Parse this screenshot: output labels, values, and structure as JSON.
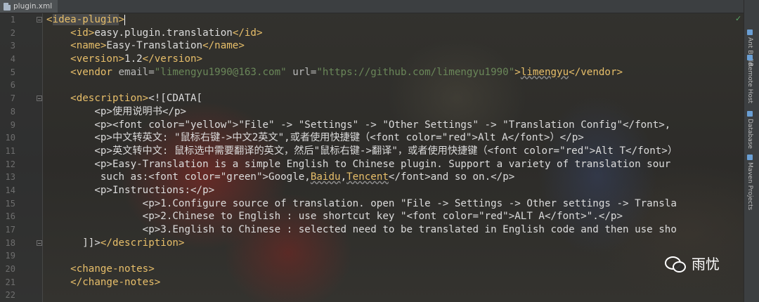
{
  "tab": {
    "label": "plugin.xml",
    "icon": "xml-file-icon"
  },
  "right_tools": [
    {
      "label": "Ant Build",
      "icon": "ant-icon"
    },
    {
      "label": "Remote Host",
      "icon": "server-icon"
    },
    {
      "label": "Database",
      "icon": "database-icon"
    },
    {
      "label": "Maven Projects",
      "icon": "maven-icon"
    }
  ],
  "status": {
    "icon": "check-icon",
    "glyph": "✓"
  },
  "watermark": {
    "text": "雨忧",
    "icon": "wechat-icon"
  },
  "lines": [
    {
      "n": "1",
      "s": [
        [
          "t",
          "<"
        ],
        [
          "hl",
          "idea-plugin"
        ],
        [
          "t",
          ">"
        ]
      ],
      "cursor": true,
      "fold": true
    },
    {
      "n": "2",
      "s": [
        [
          "t",
          "    <id>"
        ],
        [
          "tx",
          "easy.plugin.translation"
        ],
        [
          "t",
          "</id>"
        ]
      ]
    },
    {
      "n": "3",
      "s": [
        [
          "t",
          "    <name>"
        ],
        [
          "tx",
          "Easy-Translation"
        ],
        [
          "t",
          "</name>"
        ]
      ]
    },
    {
      "n": "4",
      "s": [
        [
          "t",
          "    <version>"
        ],
        [
          "tx",
          "1.2"
        ],
        [
          "t",
          "</version>"
        ]
      ]
    },
    {
      "n": "5",
      "s": [
        [
          "t",
          "    <vendor "
        ],
        [
          "at",
          "email="
        ],
        [
          "v",
          "\"limengyu1990@163.com\""
        ],
        [
          "at",
          " url="
        ],
        [
          "v",
          "\"https://github.com/limengyu1990\""
        ],
        [
          "t",
          ">"
        ],
        [
          "u",
          "limengyu"
        ],
        [
          "t",
          "</vendor>"
        ]
      ]
    },
    {
      "n": "6",
      "s": []
    },
    {
      "n": "7",
      "s": [
        [
          "t",
          "    <description>"
        ],
        [
          "tx",
          "<![CDATA["
        ]
      ],
      "fold": true
    },
    {
      "n": "8",
      "s": [
        [
          "tx",
          "        <p>使用说明书</p>"
        ]
      ]
    },
    {
      "n": "9",
      "s": [
        [
          "tx",
          "        <p><font color=\"yellow\">\"File\" -> \"Settings\" -> \"Other Settings\" -> \"Translation Config\"</font>,"
        ]
      ]
    },
    {
      "n": "10",
      "s": [
        [
          "tx",
          "        <p>中文转英文: \"鼠标右键->中文2英文\",或者使用快捷键（<font color=\"red\">Alt A</font>）</p>"
        ]
      ]
    },
    {
      "n": "11",
      "s": [
        [
          "tx",
          "        <p>英文转中文: 鼠标选中需要翻译的英文，然后\"鼠标右键->翻译\"，或者使用快捷键（<font color=\"red\">Alt T</font>）"
        ]
      ]
    },
    {
      "n": "12",
      "s": [
        [
          "tx",
          "        <p>Easy-Translation is a simple English to Chinese plugin. Support a variety of translation sour"
        ]
      ]
    },
    {
      "n": "13",
      "s": [
        [
          "tx",
          "         such as:<font color=\"green\">Google,"
        ],
        [
          "u",
          "Baidu"
        ],
        [
          "tx",
          ","
        ],
        [
          "u",
          "Tencent"
        ],
        [
          "tx",
          "</font>and so on.</p>"
        ]
      ]
    },
    {
      "n": "14",
      "s": [
        [
          "tx",
          "        <p>Instructions:</p>"
        ]
      ]
    },
    {
      "n": "15",
      "s": [
        [
          "tx",
          "                <p>1.Configure source of translation. open \"File -> Settings -> Other settings -> Transla"
        ]
      ]
    },
    {
      "n": "16",
      "s": [
        [
          "tx",
          "                <p>2.Chinese to English : use shortcut key \"<font color=\"red\">ALT A</font>\".</p>"
        ]
      ]
    },
    {
      "n": "17",
      "s": [
        [
          "tx",
          "                <p>3.English to Chinese : selected need to be translated in English code and then use sho"
        ]
      ]
    },
    {
      "n": "18",
      "s": [
        [
          "tx",
          "      ]]>"
        ],
        [
          "t",
          "</description>"
        ]
      ],
      "fold": true
    },
    {
      "n": "19",
      "s": []
    },
    {
      "n": "20",
      "s": [
        [
          "t",
          "    <change-notes>"
        ]
      ]
    },
    {
      "n": "21",
      "s": [
        [
          "t",
          "    </change-notes>"
        ]
      ]
    },
    {
      "n": "22",
      "s": []
    }
  ]
}
